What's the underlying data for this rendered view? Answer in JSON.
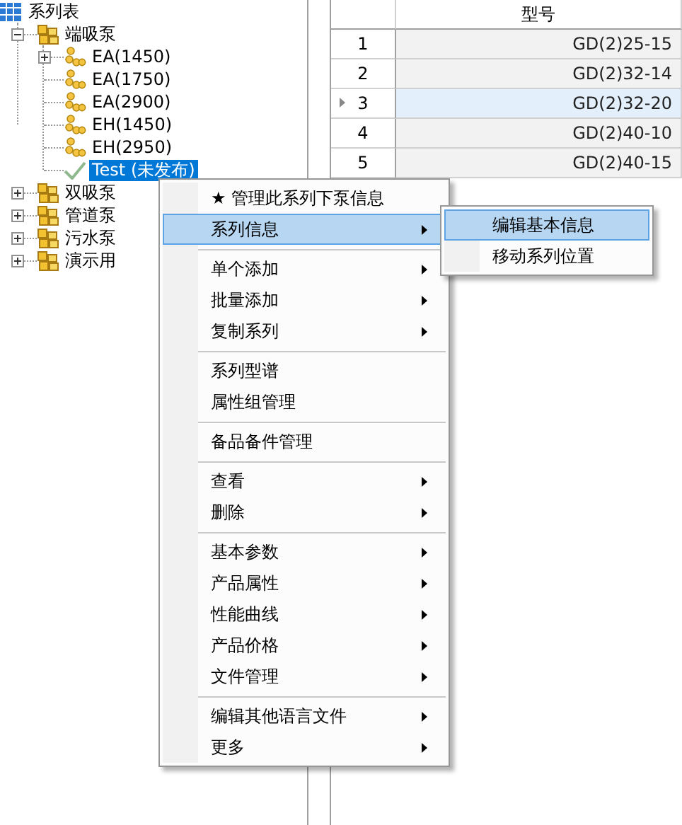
{
  "tree": {
    "label": "系列表",
    "kind": "root",
    "selected": false,
    "children": [
      {
        "label": "端吸泵",
        "kind": "group",
        "expanded": true,
        "selected": false,
        "children": [
          {
            "label": "EA(1450)",
            "kind": "series",
            "expanded": false,
            "selected": false
          },
          {
            "label": "EA(1750)",
            "kind": "series",
            "selected": false
          },
          {
            "label": "EA(2900)",
            "kind": "series",
            "selected": false
          },
          {
            "label": "EH(1450)",
            "kind": "series",
            "selected": false
          },
          {
            "label": "EH(2950)",
            "kind": "series",
            "selected": false
          },
          {
            "label": "Test (未发布)",
            "kind": "draft",
            "selected": true
          }
        ]
      },
      {
        "label": "双吸泵",
        "kind": "group",
        "expanded": false,
        "selected": false
      },
      {
        "label": "管道泵",
        "kind": "group",
        "expanded": false,
        "selected": false
      },
      {
        "label": "污水泵",
        "kind": "group",
        "expanded": false,
        "selected": false
      },
      {
        "label": "演示用",
        "kind": "group",
        "expanded": false,
        "selected": false
      }
    ]
  },
  "grid": {
    "columns": [
      {
        "label": "型号"
      }
    ],
    "rows": [
      {
        "number": "1",
        "model": "GD(2)25-15",
        "selected": false
      },
      {
        "number": "2",
        "model": "GD(2)32-14",
        "selected": false
      },
      {
        "number": "3",
        "model": "GD(2)32-20",
        "selected": true
      },
      {
        "number": "4",
        "model": "GD(2)40-10",
        "selected": false
      },
      {
        "number": "5",
        "model": "GD(2)40-15",
        "selected": false
      }
    ]
  },
  "context_menu": {
    "items": [
      {
        "kind": "item",
        "label": "★ 管理此系列下泵信息",
        "submenu": false,
        "selected": false
      },
      {
        "kind": "item",
        "label": "系列信息",
        "submenu": true,
        "selected": true
      },
      {
        "kind": "separator"
      },
      {
        "kind": "item",
        "label": "单个添加",
        "submenu": true,
        "selected": false
      },
      {
        "kind": "item",
        "label": "批量添加",
        "submenu": true,
        "selected": false
      },
      {
        "kind": "item",
        "label": "复制系列",
        "submenu": true,
        "selected": false
      },
      {
        "kind": "separator"
      },
      {
        "kind": "item",
        "label": "系列型谱",
        "submenu": false,
        "selected": false
      },
      {
        "kind": "item",
        "label": "属性组管理",
        "submenu": false,
        "selected": false
      },
      {
        "kind": "separator"
      },
      {
        "kind": "item",
        "label": "备品备件管理",
        "submenu": false,
        "selected": false
      },
      {
        "kind": "separator"
      },
      {
        "kind": "item",
        "label": "查看",
        "submenu": true,
        "selected": false
      },
      {
        "kind": "item",
        "label": "删除",
        "submenu": true,
        "selected": false
      },
      {
        "kind": "separator"
      },
      {
        "kind": "item",
        "label": "基本参数",
        "submenu": true,
        "selected": false
      },
      {
        "kind": "item",
        "label": "产品属性",
        "submenu": true,
        "selected": false
      },
      {
        "kind": "item",
        "label": "性能曲线",
        "submenu": true,
        "selected": false
      },
      {
        "kind": "item",
        "label": "产品价格",
        "submenu": true,
        "selected": false
      },
      {
        "kind": "item",
        "label": "文件管理",
        "submenu": true,
        "selected": false
      },
      {
        "kind": "separator"
      },
      {
        "kind": "item",
        "label": "编辑其他语言文件",
        "submenu": true,
        "selected": false
      },
      {
        "kind": "item",
        "label": "更多",
        "submenu": true,
        "selected": false
      }
    ]
  },
  "submenu": {
    "items": [
      {
        "kind": "item",
        "label": "编辑基本信息",
        "submenu": false,
        "selected": true
      },
      {
        "kind": "item",
        "label": "移动系列位置",
        "submenu": false,
        "selected": false
      }
    ]
  }
}
